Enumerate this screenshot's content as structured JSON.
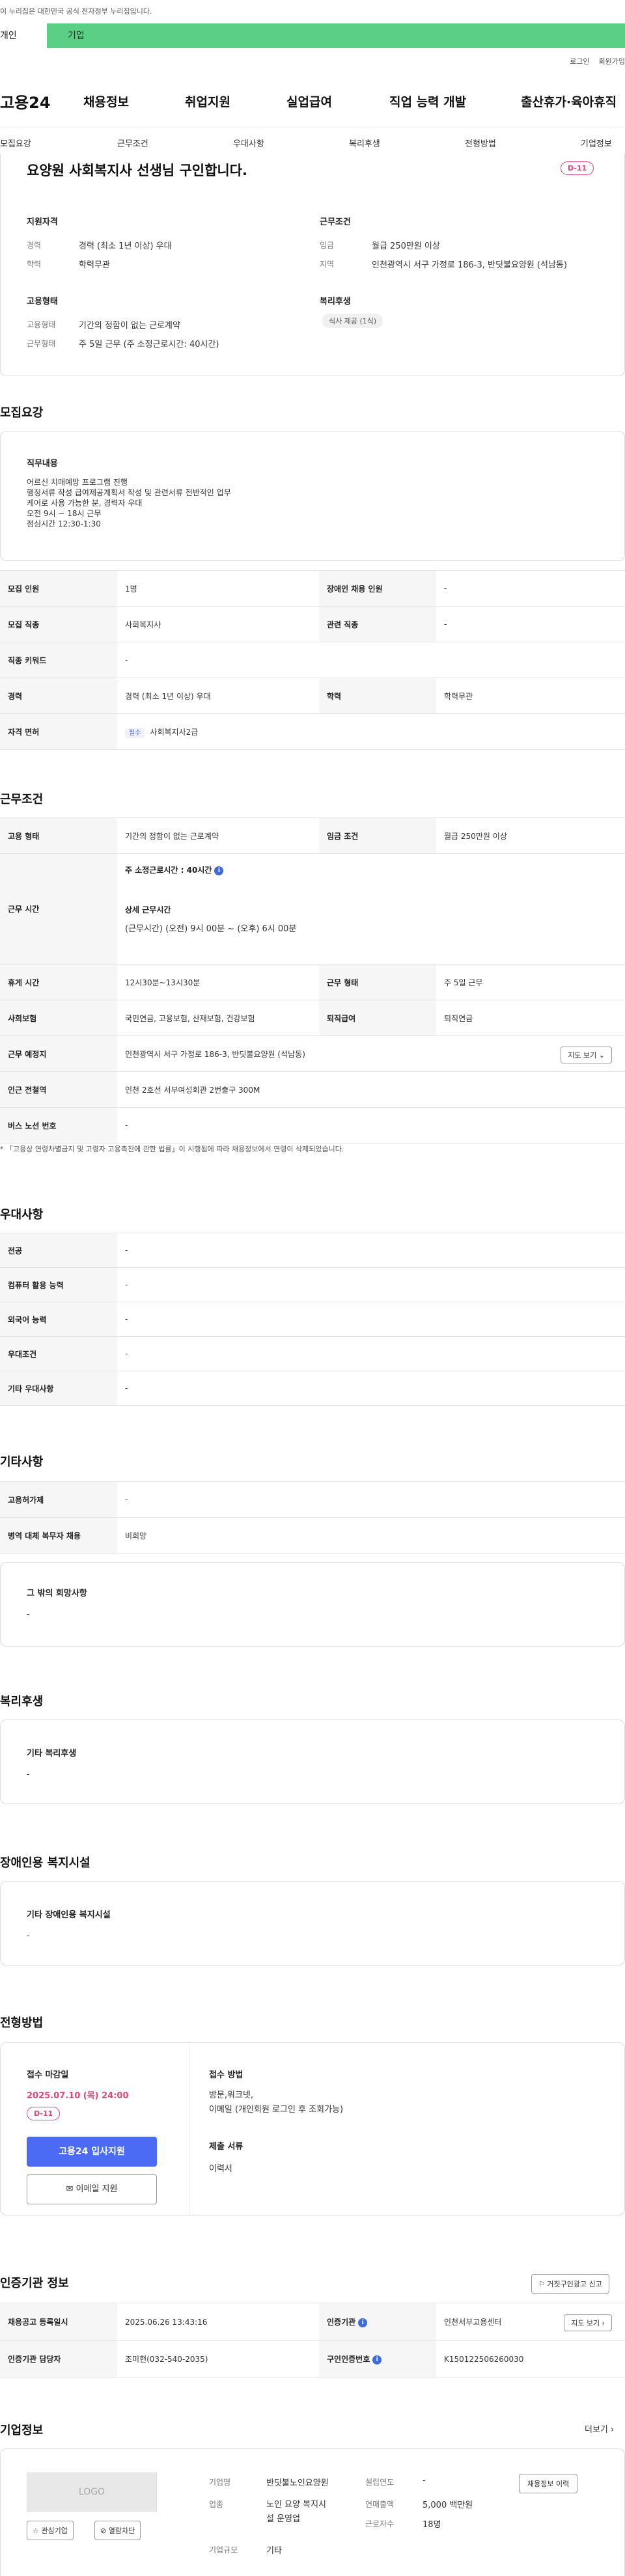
{
  "gov_banner": "이 누리집은 대한민국 공식 전자정부 누리집입니다.",
  "tabs": [
    "개인",
    "기업"
  ],
  "top_links": [
    "로그인",
    "회원가입"
  ],
  "logo": "고용24",
  "gnb": [
    "채용정보",
    "취업지원",
    "실업급여",
    "직업 능력 개발",
    "출산휴가·육아휴직"
  ],
  "subnav": [
    "모집요강",
    "근무조건",
    "우대사항",
    "복리후생",
    "전형방법",
    "기업정보"
  ],
  "job": {
    "title": "요양원 사회복지사 선생님 구인합니다.",
    "dday": "D-11",
    "qual_title": "지원자격",
    "qual": [
      {
        "k": "경력",
        "v": "경력 (최소 1년 이상) 우대"
      },
      {
        "k": "학력",
        "v": "학력무관"
      }
    ],
    "cond_title": "근무조건",
    "cond": [
      {
        "k": "임금",
        "v": "월급 250만원 이상"
      },
      {
        "k": "지역",
        "v": "인천광역시 서구 가정로 186-3, 반딧불요양원 (석남동)"
      }
    ],
    "emp_title": "고용형태",
    "emp": [
      {
        "k": "고용형태",
        "v": "기간의 정함이 없는 근로계약"
      },
      {
        "k": "근무형태",
        "v": "주 5일 근무 (주 소정근로시간: 40시간)"
      }
    ],
    "welfare_title": "복리후생",
    "welfare_tag": "식사 제공 (1식)"
  },
  "recruit": {
    "section": "모집요강",
    "duty_title": "직무내용",
    "duty_lines": [
      "어르신 치매예방 프로그램 진행",
      "행정서류 작성 급여제공계획서 작성 및 관련서류 전반적인 업무",
      "케어로 사용 가능한 분, 경력자 우대",
      "오전 9시 ~ 18시 근무",
      "점심시간 12:30-1:30"
    ],
    "rows": [
      {
        "k1": "모집 인원",
        "v1": "1명",
        "k2": "장애인 채용 인원",
        "v2": "-"
      },
      {
        "k1": "모집 직종",
        "v1": "사회복지사",
        "k2": "관련 직종",
        "v2": "-"
      },
      {
        "k1": "직종 키워드",
        "v1": "-"
      },
      {
        "k1": "경력",
        "v1": "경력 (최소 1년 이상) 우대",
        "k2": "학력",
        "v2": "학력무관"
      }
    ],
    "license_k": "자격 면허",
    "license_tag": "필수",
    "license_v": "사회복지사2급"
  },
  "work": {
    "section": "근무조건",
    "emp_k": "고용 형태",
    "emp_v": "기간의 정함이 없는 근로계약",
    "wage_k": "임금 조건",
    "wage_v": "월급 250만원 이상",
    "hours_k": "근무 시간",
    "hours_main": "주 소정근로시간 : 40시간",
    "hours_detail_title": "상세 근무시간",
    "hours_detail": "(근무시간) (오전) 9시 00분 ~ (오후) 6시 00분",
    "rest_k": "휴게 시간",
    "rest_v": "12시30분~13시30분",
    "form_k": "근무 형태",
    "form_v": "주 5일 근무",
    "ins_k": "사회보험",
    "ins_v": "국민연금, 고용보험, 산재보험, 건강보험",
    "ret_k": "퇴직급여",
    "ret_v": "퇴직연금",
    "place_k": "근무 예정지",
    "place_v": "인천광역시 서구 가정로 186-3, 반딧불요양원 (석남동)",
    "map_btn": "지도 보기",
    "subway_k": "인근 전철역",
    "subway_v": "인천 2호선 서부여성회관 2번출구 300M",
    "bus_k": "버스 노선 번호",
    "bus_v": "-",
    "note": "* 「고용상 연령차별금지 및 고령자 고용촉진에 관한 법률」이 시행됨에 따라 채용정보에서 연령이 삭제되었습니다."
  },
  "pref": {
    "section": "우대사항",
    "rows": [
      {
        "k": "전공",
        "v": "-"
      },
      {
        "k": "컴퓨터 활용 능력",
        "v": "-"
      },
      {
        "k": "외국어 능력",
        "v": "-"
      },
      {
        "k": "우대조건",
        "v": "-"
      },
      {
        "k": "기타 우대사항",
        "v": "-"
      }
    ]
  },
  "etc": {
    "section": "기타사항",
    "rows": [
      {
        "k": "고용허가제",
        "v": "-"
      },
      {
        "k": "병역 대체 복무자 채용",
        "v": "비희망"
      }
    ],
    "hope_title": "그 밖의 희망사항",
    "hope_v": "-"
  },
  "welfare": {
    "section": "복리후생",
    "title": "기타 복리후생",
    "v": "-"
  },
  "disabled": {
    "section": "장애인용 복지시설",
    "title": "기타 장애인용 복지시설",
    "v": "-"
  },
  "screen": {
    "section": "전형방법",
    "deadline_title": "접수 마감일",
    "deadline": "2025.07.10 (목) 24:00",
    "dday": "D-11",
    "apply_btn": "고용24 입사지원",
    "email_btn": "이메일 지원",
    "method_title": "접수 방법",
    "method_lines": [
      "방문,워크넷,",
      "이메일 (개인회원 로그인 후 조회가능)"
    ],
    "docs_title": "제출 서류",
    "docs_v": "이력서"
  },
  "cert": {
    "section": "인증기관 정보",
    "report_btn": "거짓구인광고 신고",
    "reg_k": "채용공고 등록일시",
    "reg_v": "2025.06.26 13:43:16",
    "org_k": "인증기관",
    "org_v": "인천서부고용센터",
    "map_btn": "지도 보기",
    "mgr_k": "인증기관 담당자",
    "mgr_v": "조미현(032-540-2035)",
    "num_k": "구인인증번호",
    "num_v": "K150122506260030"
  },
  "company": {
    "section": "기업정보",
    "more": "더보기",
    "logo": "LOGO",
    "fav_btn": "관심기업",
    "block_btn": "열람차단",
    "detail_btn": "채용정보 이력",
    "name_k": "기업명",
    "name_v": "반딧불노인요양원",
    "ind_k": "업종",
    "ind_v": [
      "노인 요양 복지시",
      "설 운영업"
    ],
    "size_k": "기업규모",
    "size_v": "기타",
    "year_k": "설립연도",
    "year_v": "-",
    "sales_k": "연매출액",
    "sales_v": "5,000 백만원",
    "emp_k": "근로자수",
    "emp_v": "18명"
  }
}
